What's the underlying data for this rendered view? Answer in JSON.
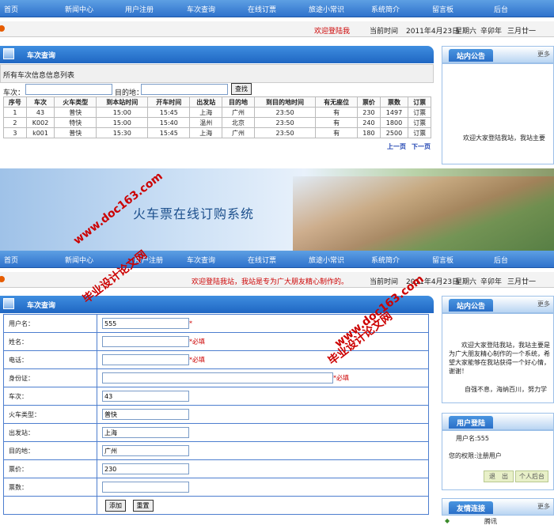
{
  "nav": [
    "首页",
    "新闻中心",
    "用户注册",
    "车次查询",
    "在线订票",
    "旅途小常识",
    "系统简介",
    "留言板",
    "后台"
  ],
  "top_info": {
    "welcome": "欢迎登陆我",
    "current_time_label": "当前时间",
    "date": "2011年4月23日",
    "weekday": "星期六",
    "lunar_year": "辛卯年",
    "lunar_day": "三月廿一"
  },
  "panel1": {
    "title": "车次查询",
    "list_caption": "所有车次信息信息列表",
    "train_label": "车次：",
    "dest_label": "目的地：",
    "search_button": "查找"
  },
  "table": {
    "headers": [
      "序号",
      "车次",
      "火车类型",
      "到本站时间",
      "开车时间",
      "出发站",
      "目的地",
      "到目的地时间",
      "有无座位",
      "票价",
      "票数",
      "订票"
    ],
    "rows": [
      [
        "1",
        "43",
        "普快",
        "15:00",
        "15:45",
        "上海",
        "广州",
        "23:50",
        "有",
        "230",
        "1497",
        "订票"
      ],
      [
        "2",
        "K002",
        "特快",
        "15:00",
        "15:40",
        "温州",
        "北京",
        "23:50",
        "有",
        "240",
        "1800",
        "订票"
      ],
      [
        "3",
        "k001",
        "普快",
        "15:30",
        "15:45",
        "上海",
        "广州",
        "23:50",
        "有",
        "180",
        "2500",
        "订票"
      ]
    ],
    "prev": "上一页",
    "next": "下一页"
  },
  "sidebar_top": {
    "notice_title": "站内公告",
    "more": "更多",
    "notice_text": "欢迎大家登陆我站，我站主要"
  },
  "banner": {
    "title": "火车票在线订购系统"
  },
  "nav2": [
    "首页",
    "新闻中心",
    "用户注册",
    "车次查询",
    "在线订票",
    "旅途小常识",
    "系统简介",
    "留言板",
    "后台"
  ],
  "info2": {
    "welcome": "欢迎登陆我站，我站是专为广大朋友精心制作的。",
    "current_time_label": "当前时间",
    "date": "2011年4月23日",
    "weekday": "星期六",
    "lunar_year": "辛卯年",
    "lunar_day": "三月廿一"
  },
  "panel2": {
    "title": "车次查询"
  },
  "form": {
    "labels": [
      "用户名：",
      "姓名：",
      "电话：",
      "身份证：",
      "车次：",
      "火车类型：",
      "出发站：",
      "目的地：",
      "票价：",
      "票数："
    ],
    "values": [
      "555",
      "",
      "",
      "",
      "43",
      "普快",
      "上海",
      "广州",
      "230",
      ""
    ],
    "required": "*必填",
    "add_button": "添加",
    "reset_button": "重置"
  },
  "sidebar2": {
    "notice_title": "站内公告",
    "more": "更多",
    "notice_text": "欢迎大家登陆我站，我站主要是为广大朋友精心制作的一个系统，希望大家能够在我站获得一个好心情，谢谢！",
    "motto": "自强不息，海纳百川，努力学",
    "login_title": "用户登陆",
    "username_line": "用户名:555",
    "permission_line": "您的权限:注册用户",
    "logout_button": "退　出",
    "personal_button": "个人后台",
    "links_title": "友情连接",
    "links_more": "更多",
    "link1": "腾讯"
  },
  "watermark": {
    "line1": "www.doc163.com",
    "line2": "毕业设计论文网"
  }
}
